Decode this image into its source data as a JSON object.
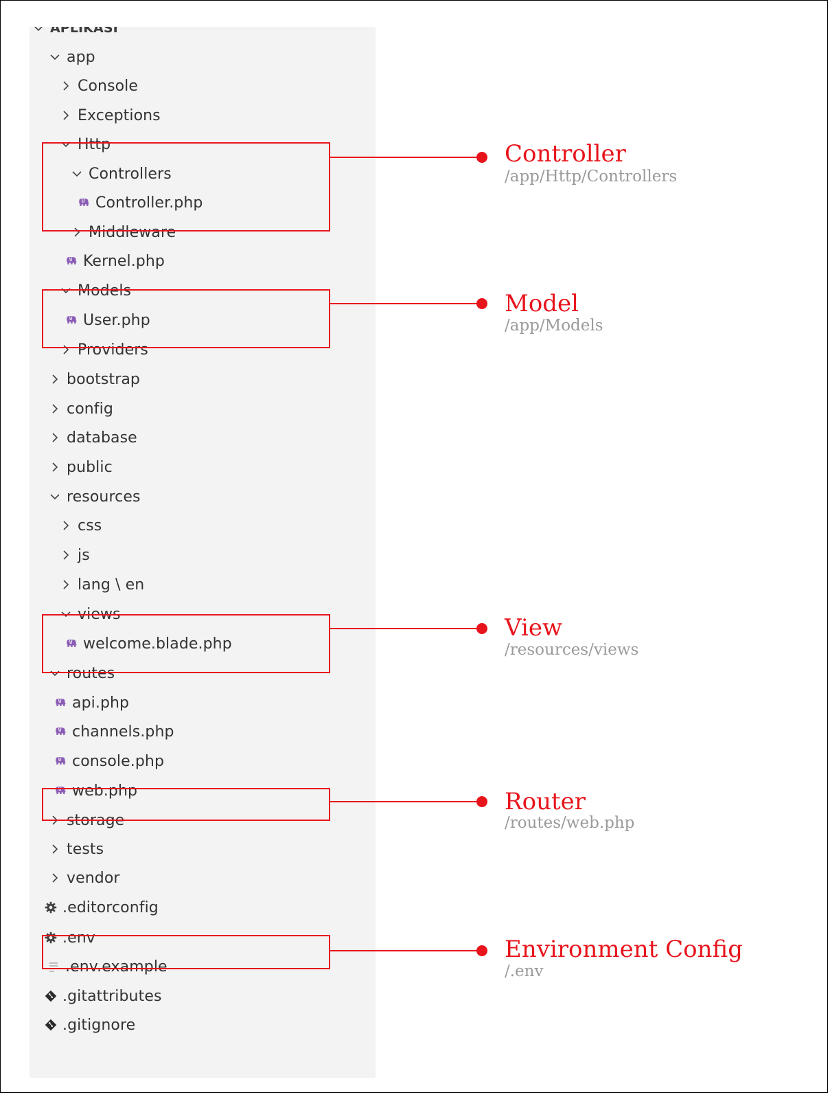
{
  "explorer": {
    "items": [
      {
        "label": "APLIKASI",
        "icon": "chevron-down-icon",
        "header": true
      },
      {
        "label": "app",
        "icon": "chevron-down-icon"
      },
      {
        "label": "Console",
        "icon": "chevron-right-icon"
      },
      {
        "label": "Exceptions",
        "icon": "chevron-right-icon"
      },
      {
        "label": "Http",
        "icon": "chevron-down-icon"
      },
      {
        "label": "Controllers",
        "icon": "chevron-down-icon"
      },
      {
        "label": "Controller.php",
        "icon": "php-elephant-icon"
      },
      {
        "label": "Middleware",
        "icon": "chevron-right-icon"
      },
      {
        "label": "Kernel.php",
        "icon": "php-elephant-icon"
      },
      {
        "label": "Models",
        "icon": "chevron-down-icon"
      },
      {
        "label": "User.php",
        "icon": "php-elephant-icon"
      },
      {
        "label": "Providers",
        "icon": "chevron-right-icon"
      },
      {
        "label": "bootstrap",
        "icon": "chevron-right-icon"
      },
      {
        "label": "config",
        "icon": "chevron-right-icon"
      },
      {
        "label": "database",
        "icon": "chevron-right-icon"
      },
      {
        "label": "public",
        "icon": "chevron-right-icon"
      },
      {
        "label": "resources",
        "icon": "chevron-down-icon"
      },
      {
        "label": "css",
        "icon": "chevron-right-icon"
      },
      {
        "label": "js",
        "icon": "chevron-right-icon"
      },
      {
        "label": "lang \\ en",
        "icon": "chevron-right-icon"
      },
      {
        "label": "views",
        "icon": "chevron-down-icon"
      },
      {
        "label": "welcome.blade.php",
        "icon": "php-elephant-icon"
      },
      {
        "label": "routes",
        "icon": "chevron-down-icon"
      },
      {
        "label": "api.php",
        "icon": "php-elephant-icon"
      },
      {
        "label": "channels.php",
        "icon": "php-elephant-icon"
      },
      {
        "label": "console.php",
        "icon": "php-elephant-icon"
      },
      {
        "label": "web.php",
        "icon": "php-elephant-icon"
      },
      {
        "label": "storage",
        "icon": "chevron-right-icon"
      },
      {
        "label": "tests",
        "icon": "chevron-right-icon"
      },
      {
        "label": "vendor",
        "icon": "chevron-right-icon"
      },
      {
        "label": ".editorconfig",
        "icon": "gear-icon"
      },
      {
        "label": ".env",
        "icon": "gear-icon"
      },
      {
        "label": ".env.example",
        "icon": "text-file-icon"
      },
      {
        "label": ".gitattributes",
        "icon": "git-icon"
      },
      {
        "label": ".gitignore",
        "icon": "git-icon"
      }
    ]
  },
  "annotations": [
    {
      "title": "Controller",
      "path": "/app/Http/Controllers"
    },
    {
      "title": "Model",
      "path": "/app/Models"
    },
    {
      "title": "View",
      "path": "/resources/views"
    },
    {
      "title": "Router",
      "path": "/routes/web.php"
    },
    {
      "title": "Environment Config",
      "path": "/.env"
    }
  ],
  "colors": {
    "accent": "#e8141c",
    "sidebar_bg": "#f3f3f3",
    "php_icon": "#8a5cb5",
    "subtitle": "#9a9a9a"
  }
}
